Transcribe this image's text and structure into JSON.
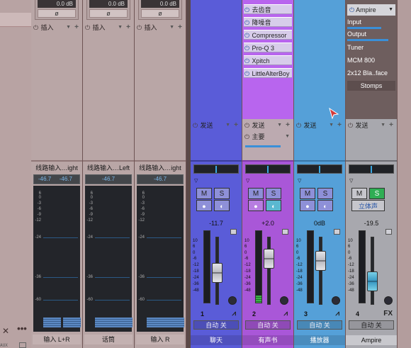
{
  "left": {
    "close": "✕",
    "more": "•••",
    "aux": "AUX"
  },
  "analog": [
    {
      "gain": "0.0 dB",
      "phase": "ø",
      "insert": "插入",
      "header": "线路输入…ight",
      "peak": [
        "-46.7",
        "-46.7"
      ],
      "name": "输入 L+R"
    },
    {
      "gain": "0.0 dB",
      "phase": "ø",
      "insert": "插入",
      "header": "线路输入…Left",
      "peak": [
        "-46.7"
      ],
      "name": "话筒"
    },
    {
      "gain": "0.0 dB",
      "phase": "ø",
      "insert": "插入",
      "header": "线路输入…ight",
      "peak": [
        "-46.7"
      ],
      "name": "输入 R"
    }
  ],
  "meter_ticks": [
    "6",
    "0",
    "-3",
    "-6",
    "-9",
    "-12",
    "-24",
    "-36",
    "-60"
  ],
  "fader_ticks": [
    "10",
    "6",
    "0",
    "-6",
    "-12",
    "-18",
    "-24",
    "-36",
    "-48"
  ],
  "channels": [
    {
      "name": "聊天",
      "send": "发送",
      "pan": "<C>",
      "m": "M",
      "s": "S",
      "vol": "-11.7",
      "num": "1",
      "auto": "自动 关",
      "color": "#5a5cd8",
      "fader": 0.47,
      "meter": 0.0
    },
    {
      "name": "有声书",
      "send": "发送",
      "send2": "主要",
      "pan": "<C>",
      "m": "M",
      "s": "S",
      "vol": "+2.0",
      "num": "2",
      "auto": "自动 关",
      "color": "#a957d8",
      "fader": 0.76,
      "meter": 0.1,
      "plugins": [
        "去齿音",
        "降噪音",
        "Compressor",
        "Pro-Q 3",
        "Xpitch",
        "LittleAlterBoy"
      ]
    },
    {
      "name": "播放器",
      "send": "发送",
      "pan": "<C>",
      "m": "M",
      "s": "S",
      "vol": "0dB",
      "num": "3",
      "auto": "自动 关",
      "color": "#55a0d8",
      "fader": 0.72,
      "meter": 0.0
    },
    {
      "name": "Ampire",
      "send": "发送",
      "pan": "<C>",
      "m": "M",
      "s": "S",
      "stereo": "立体声",
      "vol": "-19.5",
      "num": "4",
      "fx": "FX",
      "auto": "自动 关",
      "color": "#a8a8ae",
      "fader": 0.3,
      "meter": 0.0,
      "amp": {
        "plugin": "Ampire",
        "input": "Input",
        "output": "Output",
        "tuner": "Tuner",
        "cab": "MCM 800",
        "mic": "2x12 Bla..face",
        "stomps": "Stomps"
      }
    }
  ]
}
